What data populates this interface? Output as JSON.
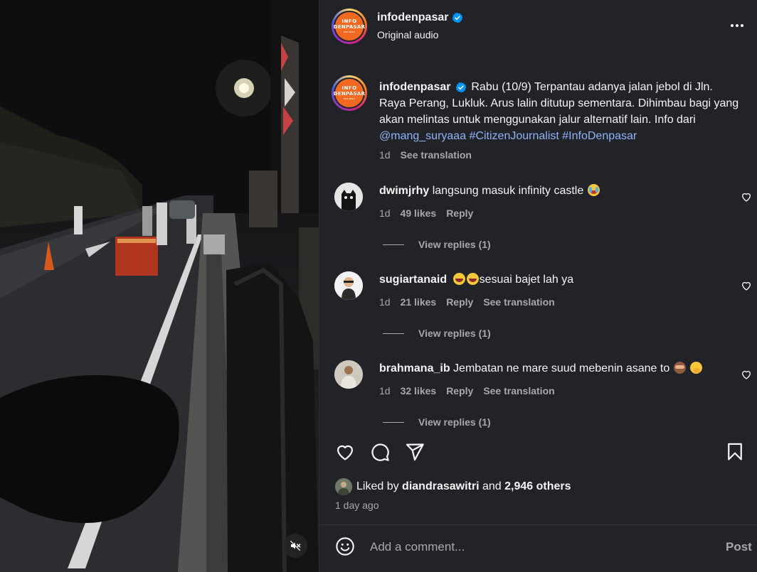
{
  "post": {
    "username": "infodenpasar",
    "verified": true,
    "audio_label": "Original audio",
    "avatar_text": {
      "line1": "INFO",
      "line2": "DENPASAR",
      "line3": "EST 2015"
    },
    "caption": {
      "username": "infodenpasar",
      "text": "Rabu (10/9) Terpantau adanya jalan jebol di Jln. Raya Perang, Lukluk. Arus lalin ditutup sementara. Dihimbau bagi yang akan melintas untuk menggunakan jalur alternatif lain. Info dari ",
      "mention": "@mang_suryaaa",
      "hashtag1": "#CitizenJournalist",
      "hashtag2": "#InfoDenpasar",
      "time": "1d",
      "see_translation": "See translation"
    }
  },
  "comments": [
    {
      "username": "dwimjrhy",
      "text": "langsung masuk infinity castle",
      "emoji": "crying-face",
      "time": "1d",
      "likes": "49 likes",
      "reply": "Reply",
      "view_replies": "View replies (1)"
    },
    {
      "username": "sugiartanaid",
      "text": "sesuai bajet lah ya",
      "emoji": "laughing-face",
      "time": "1d",
      "likes": "21 likes",
      "reply": "Reply",
      "see_translation": "See translation",
      "view_replies": "View replies (1)"
    },
    {
      "username": "brahmana_ib",
      "text": "Jembatan ne mare suud mebenin asane to",
      "emoji": "see-no-evil-monkey, face-with-hand-over-mouth",
      "time": "1d",
      "likes": "32 likes",
      "reply": "Reply",
      "see_translation": "See translation",
      "view_replies": "View replies (1)"
    }
  ],
  "likes": {
    "prefix": "Liked by ",
    "user": "diandrasawitri",
    "middle": " and ",
    "others": "2,946 others"
  },
  "timestamp": "1 day ago",
  "comment_box": {
    "placeholder": "Add a comment...",
    "post_label": "Post"
  },
  "icons": [
    "verified-badge-icon",
    "more-icon",
    "heart-icon",
    "comment-icon",
    "share-icon",
    "bookmark-icon",
    "emoji-icon",
    "mute-icon"
  ],
  "colors": {
    "panel_bg": "#212328",
    "link": "#8fb3f7",
    "verified": "#0095f6",
    "logo_orange": "#f26a21",
    "muted_text": "#a8a8a8"
  }
}
